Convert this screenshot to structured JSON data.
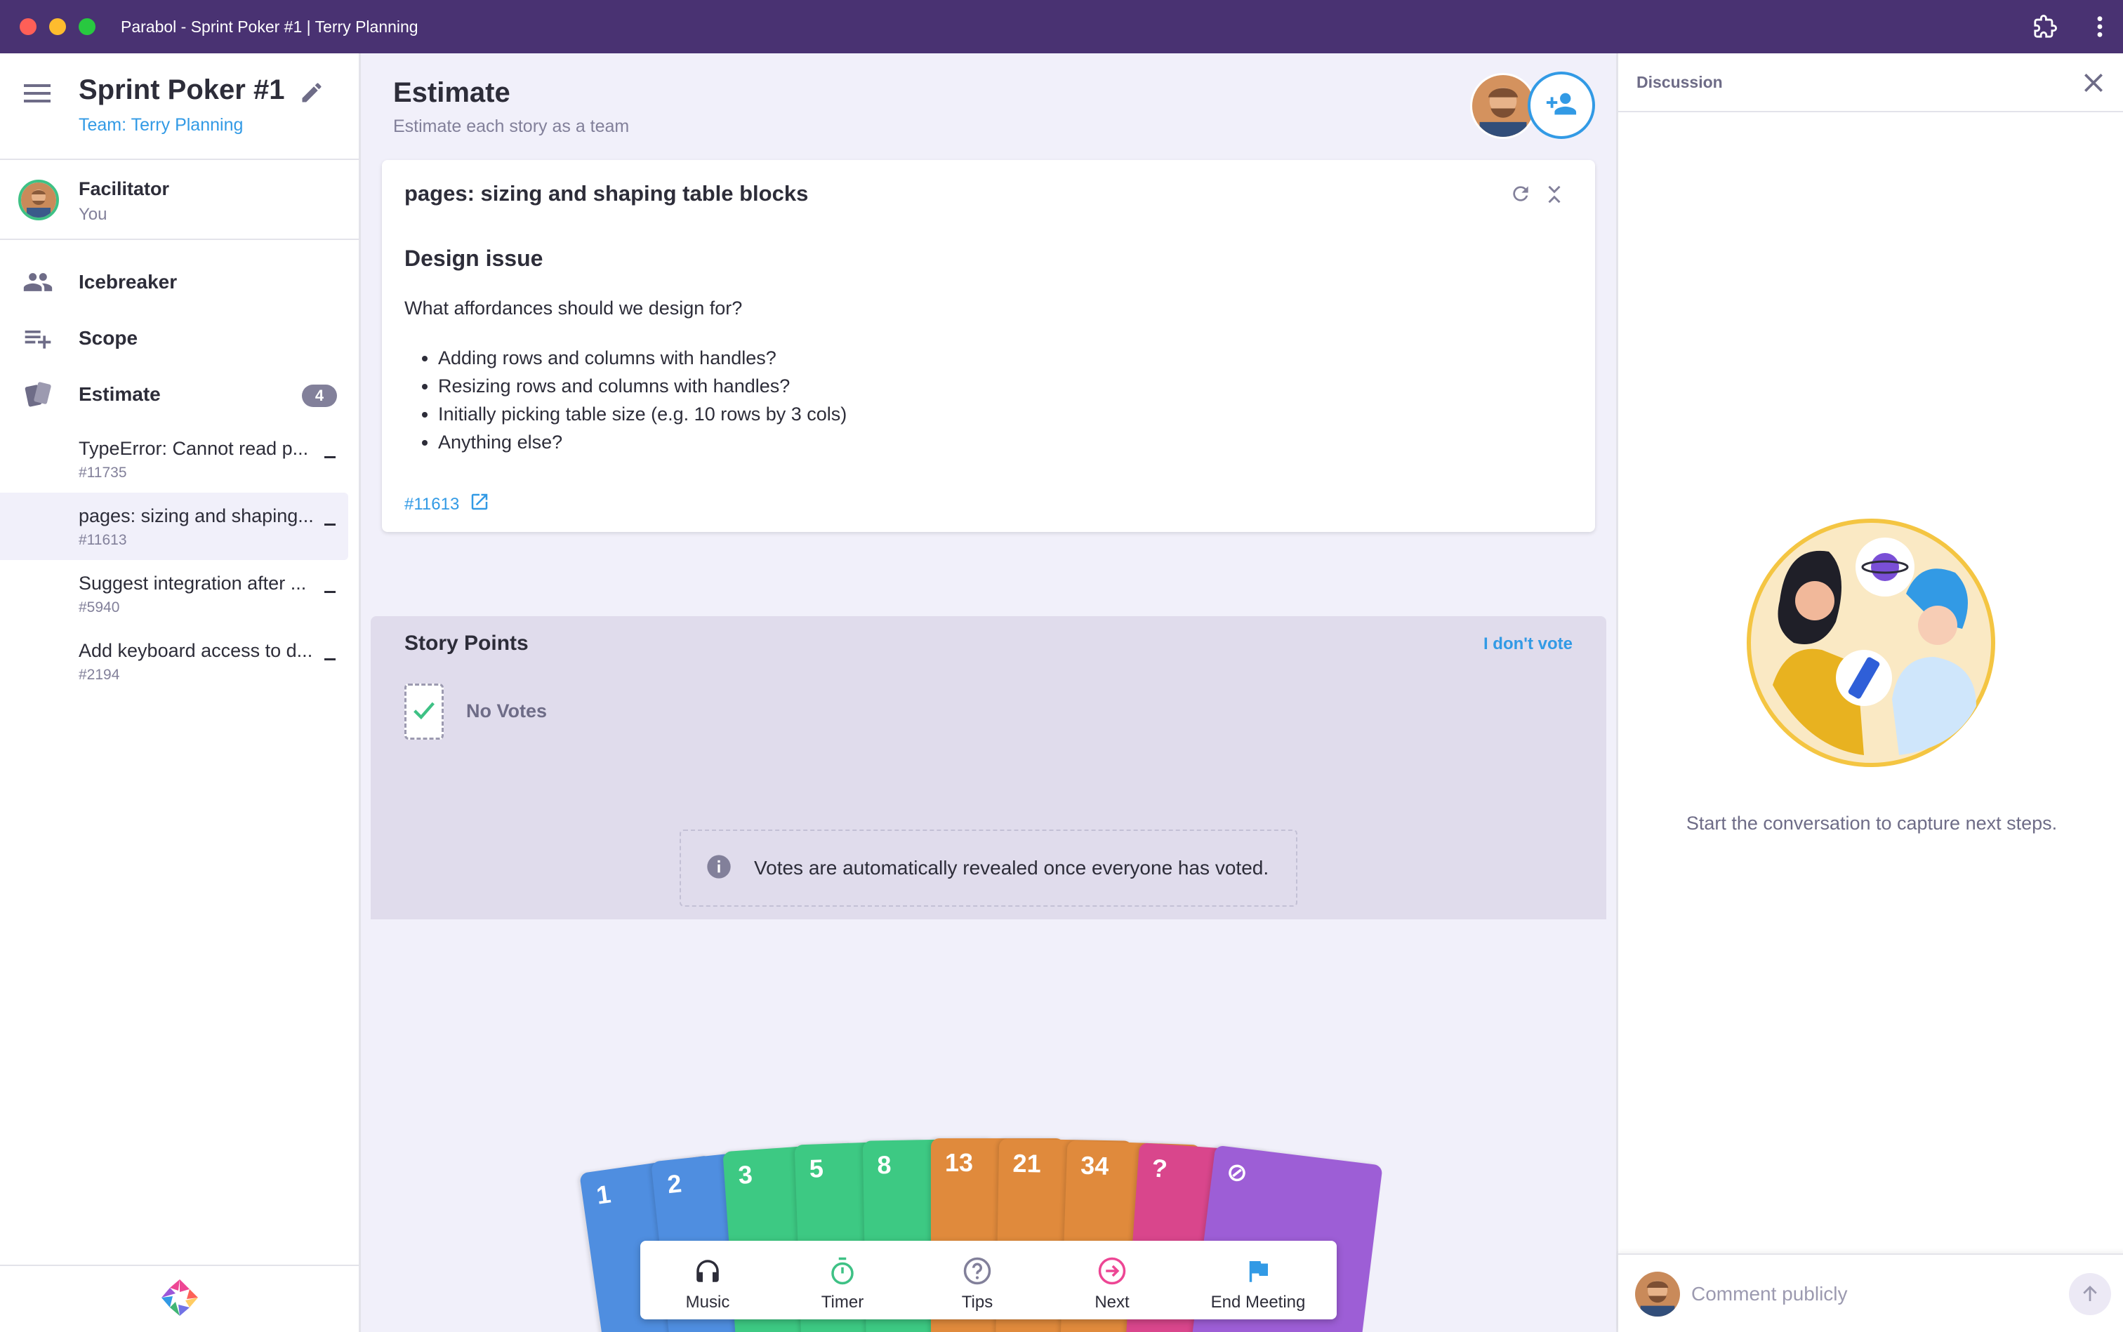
{
  "window": {
    "title": "Parabol - Sprint Poker #1 | Terry Planning"
  },
  "sidebar": {
    "meeting_name": "Sprint Poker #1",
    "team_link": "Team: Terry Planning",
    "facilitator": {
      "role": "Facilitator",
      "name": "You"
    },
    "nav": [
      {
        "label": "Icebreaker",
        "icon": "people-icon"
      },
      {
        "label": "Scope",
        "icon": "playlist-add-icon"
      },
      {
        "label": "Estimate",
        "icon": "cards-icon",
        "badge": "4"
      }
    ],
    "stories": [
      {
        "title": "TypeError: Cannot read p...",
        "id": "#11735",
        "active": false
      },
      {
        "title": "pages: sizing and shaping...",
        "id": "#11613",
        "active": true
      },
      {
        "title": "Suggest integration after ...",
        "id": "#5940",
        "active": false
      },
      {
        "title": "Add keyboard access to d...",
        "id": "#2194",
        "active": false
      }
    ]
  },
  "main": {
    "title": "Estimate",
    "subtitle": "Estimate each story as a team",
    "story": {
      "title": "pages: sizing and shaping table blocks",
      "heading": "Design issue",
      "question": "What affordances should we design for?",
      "bullets": [
        "Adding rows and columns with handles?",
        "Resizing rows and columns with handles?",
        "Initially picking table size (e.g. 10 rows by 3 cols)",
        "Anything else?"
      ],
      "link": "#11613"
    },
    "points": {
      "title": "Story Points",
      "dont_vote": "I don't vote",
      "no_votes": "No Votes",
      "reveal_note": "Votes are automatically revealed once everyone has voted."
    },
    "cards": [
      {
        "label": "1",
        "color": "#4f8ee0"
      },
      {
        "label": "2",
        "color": "#4f8ee0"
      },
      {
        "label": "3",
        "color": "#3dc983"
      },
      {
        "label": "5",
        "color": "#3dc983"
      },
      {
        "label": "8",
        "color": "#3dc983"
      },
      {
        "label": "13",
        "color": "#e08a3c"
      },
      {
        "label": "21",
        "color": "#e08a3c"
      },
      {
        "label": "34",
        "color": "#e08a3c"
      },
      {
        "label": "?",
        "color": "#d9468c"
      },
      {
        "label": "⊘",
        "color": "#9d5ed6"
      }
    ],
    "toolbar": {
      "music": "Music",
      "timer": "Timer",
      "tips": "Tips",
      "next": "Next",
      "end": "End Meeting"
    }
  },
  "discussion": {
    "title": "Discussion",
    "empty_text": "Start the conversation to capture next steps.",
    "comment_placeholder": "Comment publicly"
  },
  "colors": {
    "titlebar": "#493272",
    "accent_blue": "#329ae5",
    "background": "#f1f0fa"
  }
}
